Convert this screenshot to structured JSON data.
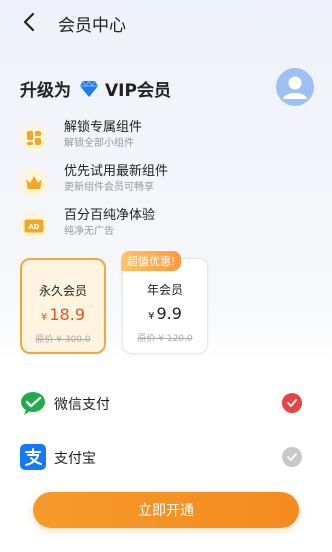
{
  "header": {
    "title": "会员中心"
  },
  "upgrade": {
    "prefix": "升级为",
    "vip": "VIP会员"
  },
  "features": [
    {
      "icon": "widgets-icon",
      "title": "解锁专属组件",
      "subtitle": "解锁全部小组件"
    },
    {
      "icon": "crown-icon",
      "title": "优先试用最新组件",
      "subtitle": "更新组件会员可畅享"
    },
    {
      "icon": "no-ads-icon",
      "title": "百分百纯净体验",
      "subtitle": "纯净无广告"
    }
  ],
  "plans": [
    {
      "name": "永久会员",
      "currency": "¥",
      "price": "18.9",
      "original": "原价 ¥ 300.0",
      "selected": true
    },
    {
      "name": "年会员",
      "currency": "¥",
      "price": "9.9",
      "original": "原价 ¥ 120.0",
      "badge": "超值优惠!",
      "selected": false
    }
  ],
  "payments": [
    {
      "icon": "wechat-pay-icon",
      "label": "微信支付",
      "checked": true
    },
    {
      "icon": "alipay-icon",
      "label": "支付宝",
      "checked": false
    }
  ],
  "cta": {
    "label": "立即开通"
  },
  "colors": {
    "accent": "#f79a2a",
    "price": "#e6541f",
    "check": "#e64545",
    "vip": "#1e7bf0"
  }
}
